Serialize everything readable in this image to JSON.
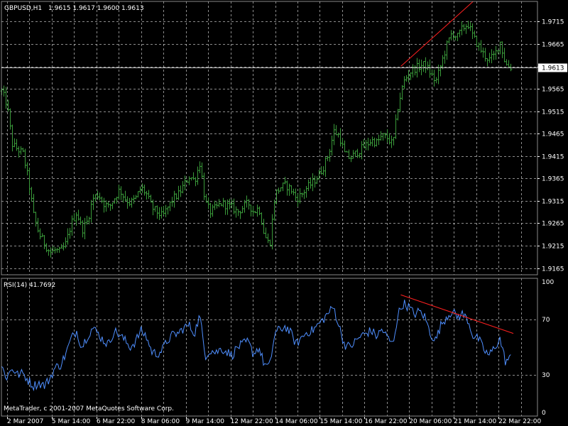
{
  "header": {
    "symbol": "GBPUSD,H1",
    "ohlc": "1.9615 1.9617 1.9600 1.9613"
  },
  "rsi_header": "RSI(14) 41.7692",
  "copyright": "MetaTrader, c 2001-2007 MetaQuotes Software Corp.",
  "colors": {
    "background": "#000000",
    "grid": "#ffffff",
    "price_bars": "#3a9a3a",
    "rsi_line": "#4f8fff",
    "trendline": "#ff2020"
  },
  "chart_data": [
    {
      "type": "bar",
      "name": "price",
      "symbol": "GBPUSD",
      "timeframe": "H1",
      "ylim": [
        1.915,
        1.976
      ],
      "yticks": [
        "1.9715",
        "1.9665",
        "1.9615",
        "1.9565",
        "1.9515",
        "1.9465",
        "1.9415",
        "1.9365",
        "1.9315",
        "1.9265",
        "1.9215",
        "1.9165"
      ],
      "current_price_label": "1.9613",
      "current_price": 1.9613,
      "grid": true,
      "trendline": {
        "from": [
          0.745,
          1.9615
        ],
        "to": [
          0.88,
          1.976
        ]
      },
      "close_profile": [
        [
          0.0,
          1.956
        ],
        [
          0.01,
          1.953
        ],
        [
          0.02,
          1.944
        ],
        [
          0.03,
          1.943
        ],
        [
          0.04,
          1.942
        ],
        [
          0.05,
          1.936
        ],
        [
          0.06,
          1.928
        ],
        [
          0.07,
          1.924
        ],
        [
          0.08,
          1.922
        ],
        [
          0.09,
          1.92
        ],
        [
          0.1,
          1.9205
        ],
        [
          0.11,
          1.92
        ],
        [
          0.12,
          1.922
        ],
        [
          0.13,
          1.9265
        ],
        [
          0.14,
          1.929
        ],
        [
          0.15,
          1.925
        ],
        [
          0.16,
          1.927
        ],
        [
          0.17,
          1.932
        ],
        [
          0.18,
          1.933
        ],
        [
          0.19,
          1.931
        ],
        [
          0.2,
          1.93
        ],
        [
          0.21,
          1.932
        ],
        [
          0.22,
          1.934
        ],
        [
          0.23,
          1.932
        ],
        [
          0.24,
          1.931
        ],
        [
          0.25,
          1.932
        ],
        [
          0.26,
          1.9345
        ],
        [
          0.27,
          1.933
        ],
        [
          0.28,
          1.93
        ],
        [
          0.29,
          1.929
        ],
        [
          0.3,
          1.928
        ],
        [
          0.31,
          1.93
        ],
        [
          0.32,
          1.932
        ],
        [
          0.33,
          1.933
        ],
        [
          0.34,
          1.935
        ],
        [
          0.35,
          1.937
        ],
        [
          0.36,
          1.936
        ],
        [
          0.37,
          1.94
        ],
        [
          0.38,
          1.931
        ],
        [
          0.39,
          1.929
        ],
        [
          0.4,
          1.93
        ],
        [
          0.41,
          1.931
        ],
        [
          0.42,
          1.9305
        ],
        [
          0.43,
          1.93
        ],
        [
          0.44,
          1.929
        ],
        [
          0.45,
          1.93
        ],
        [
          0.46,
          1.931
        ],
        [
          0.47,
          1.929
        ],
        [
          0.48,
          1.93
        ],
        [
          0.49,
          1.924
        ],
        [
          0.5,
          1.9215
        ],
        [
          0.51,
          1.933
        ],
        [
          0.52,
          1.9345
        ],
        [
          0.53,
          1.935
        ],
        [
          0.54,
          1.934
        ],
        [
          0.55,
          1.932
        ],
        [
          0.56,
          1.933
        ],
        [
          0.57,
          1.9345
        ],
        [
          0.58,
          1.9355
        ],
        [
          0.59,
          1.937
        ],
        [
          0.6,
          1.939
        ],
        [
          0.61,
          1.942
        ],
        [
          0.62,
          1.947
        ],
        [
          0.63,
          1.946
        ],
        [
          0.64,
          1.942
        ],
        [
          0.65,
          1.941
        ],
        [
          0.66,
          1.942
        ],
        [
          0.67,
          1.943
        ],
        [
          0.68,
          1.944
        ],
        [
          0.69,
          1.945
        ],
        [
          0.7,
          1.9445
        ],
        [
          0.71,
          1.946
        ],
        [
          0.72,
          1.9455
        ],
        [
          0.73,
          1.944
        ],
        [
          0.74,
          1.953
        ],
        [
          0.75,
          1.958
        ],
        [
          0.76,
          1.96
        ],
        [
          0.77,
          1.961
        ],
        [
          0.78,
          1.9615
        ],
        [
          0.79,
          1.962
        ],
        [
          0.8,
          1.96
        ],
        [
          0.81,
          1.958
        ],
        [
          0.82,
          1.962
        ],
        [
          0.83,
          1.966
        ],
        [
          0.84,
          1.969
        ],
        [
          0.85,
          1.968
        ],
        [
          0.86,
          1.97
        ],
        [
          0.87,
          1.971
        ],
        [
          0.88,
          1.968
        ],
        [
          0.89,
          1.966
        ],
        [
          0.9,
          1.964
        ],
        [
          0.91,
          1.963
        ],
        [
          0.92,
          1.964
        ],
        [
          0.93,
          1.967
        ],
        [
          0.94,
          1.962
        ],
        [
          0.95,
          1.9613
        ]
      ]
    },
    {
      "type": "line",
      "name": "RSI(14)",
      "ylim": [
        0,
        100
      ],
      "yticks": [
        "100",
        "70",
        "30",
        "0"
      ],
      "levels": [
        70,
        30
      ],
      "last_value": 41.7692,
      "trendline": {
        "from": [
          0.745,
          88
        ],
        "to": [
          0.955,
          60
        ]
      },
      "values": [
        [
          0.0,
          36
        ],
        [
          0.01,
          28
        ],
        [
          0.02,
          35
        ],
        [
          0.03,
          30
        ],
        [
          0.04,
          31
        ],
        [
          0.05,
          26
        ],
        [
          0.06,
          22
        ],
        [
          0.07,
          24
        ],
        [
          0.08,
          22
        ],
        [
          0.09,
          27
        ],
        [
          0.1,
          35
        ],
        [
          0.11,
          37
        ],
        [
          0.12,
          45
        ],
        [
          0.13,
          56
        ],
        [
          0.14,
          62
        ],
        [
          0.15,
          50
        ],
        [
          0.16,
          58
        ],
        [
          0.17,
          64
        ],
        [
          0.18,
          60
        ],
        [
          0.19,
          55
        ],
        [
          0.2,
          52
        ],
        [
          0.21,
          62
        ],
        [
          0.22,
          59
        ],
        [
          0.23,
          55
        ],
        [
          0.24,
          50
        ],
        [
          0.25,
          54
        ],
        [
          0.26,
          62
        ],
        [
          0.27,
          58
        ],
        [
          0.28,
          47
        ],
        [
          0.29,
          45
        ],
        [
          0.3,
          48
        ],
        [
          0.31,
          55
        ],
        [
          0.32,
          59
        ],
        [
          0.33,
          60
        ],
        [
          0.34,
          64
        ],
        [
          0.35,
          66
        ],
        [
          0.36,
          60
        ],
        [
          0.37,
          73
        ],
        [
          0.38,
          44
        ],
        [
          0.39,
          48
        ],
        [
          0.4,
          46
        ],
        [
          0.41,
          49
        ],
        [
          0.42,
          47
        ],
        [
          0.43,
          44
        ],
        [
          0.44,
          50
        ],
        [
          0.45,
          52
        ],
        [
          0.46,
          54
        ],
        [
          0.47,
          45
        ],
        [
          0.48,
          50
        ],
        [
          0.49,
          38
        ],
        [
          0.5,
          35
        ],
        [
          0.51,
          60
        ],
        [
          0.52,
          63
        ],
        [
          0.53,
          65
        ],
        [
          0.54,
          60
        ],
        [
          0.55,
          52
        ],
        [
          0.56,
          57
        ],
        [
          0.57,
          61
        ],
        [
          0.58,
          62
        ],
        [
          0.59,
          66
        ],
        [
          0.6,
          70
        ],
        [
          0.61,
          75
        ],
        [
          0.62,
          79
        ],
        [
          0.63,
          65
        ],
        [
          0.64,
          52
        ],
        [
          0.65,
          50
        ],
        [
          0.66,
          54
        ],
        [
          0.67,
          58
        ],
        [
          0.68,
          60
        ],
        [
          0.69,
          62
        ],
        [
          0.7,
          58
        ],
        [
          0.71,
          63
        ],
        [
          0.72,
          57
        ],
        [
          0.73,
          52
        ],
        [
          0.74,
          74
        ],
        [
          0.75,
          82
        ],
        [
          0.76,
          79
        ],
        [
          0.77,
          74
        ],
        [
          0.78,
          76
        ],
        [
          0.79,
          72
        ],
        [
          0.8,
          60
        ],
        [
          0.81,
          55
        ],
        [
          0.82,
          66
        ],
        [
          0.83,
          72
        ],
        [
          0.84,
          76
        ],
        [
          0.85,
          72
        ],
        [
          0.86,
          74
        ],
        [
          0.87,
          70
        ],
        [
          0.88,
          58
        ],
        [
          0.89,
          56
        ],
        [
          0.9,
          48
        ],
        [
          0.91,
          44
        ],
        [
          0.92,
          50
        ],
        [
          0.93,
          56
        ],
        [
          0.94,
          40
        ],
        [
          0.95,
          42
        ]
      ]
    }
  ],
  "x_axis": {
    "ticks": [
      "2 Mar 2007",
      "5 Mar 14:00",
      "6 Mar 22:00",
      "8 Mar 06:00",
      "9 Mar 14:00",
      "12 Mar 22:00",
      "14 Mar 06:00",
      "15 Mar 14:00",
      "16 Mar 22:00",
      "20 Mar 06:00",
      "21 Mar 14:00",
      "22 Mar 22:00"
    ]
  }
}
